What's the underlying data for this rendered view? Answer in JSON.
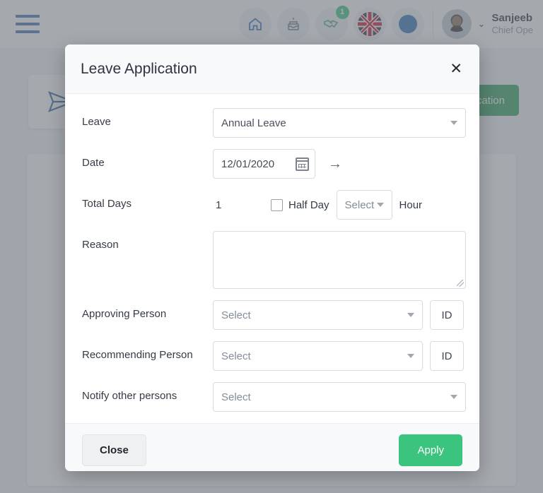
{
  "topbar": {
    "menu_icon": "hamburger-icon",
    "icons": [
      {
        "name": "home-icon",
        "glyph": "⌂",
        "color": "#2f6fb5",
        "badge": null
      },
      {
        "name": "cake-icon",
        "glyph": "⌂",
        "color": "#7b828c",
        "badge": null
      },
      {
        "name": "handshake-icon",
        "glyph": "⌂",
        "color": "#4fae7d",
        "badge": "1"
      },
      {
        "name": "flag-uk-icon",
        "glyph": "⌂",
        "color": "#c8102e",
        "badge": null
      },
      {
        "name": "status-dot-icon",
        "glyph": "●",
        "color": "#2f6fb5",
        "badge": null
      }
    ],
    "user": {
      "name": "Sanjeeb",
      "role": "Chief Ope",
      "chevron": "⌄"
    }
  },
  "background": {
    "send_icon": "send-icon",
    "apply_button_label": "cation"
  },
  "modal": {
    "title": "Leave Application",
    "close_icon": "✕",
    "fields": {
      "leave": {
        "label": "Leave",
        "value": "Annual Leave"
      },
      "date": {
        "label": "Date",
        "value": "12/01/2020",
        "calendar_icon": "calendar-icon",
        "arrow_icon": "→"
      },
      "total_days": {
        "label": "Total Days",
        "value": "1",
        "half_day_label": "Half Day",
        "half_day_checked": false,
        "hour_select_placeholder": "Select",
        "hour_label": "Hour"
      },
      "reason": {
        "label": "Reason",
        "value": ""
      },
      "approving_person": {
        "label": "Approving Person",
        "placeholder": "Select",
        "id_button_label": "ID"
      },
      "recommending_person": {
        "label": "Recommending Person",
        "placeholder": "Select",
        "id_button_label": "ID"
      },
      "notify_other_persons": {
        "label": "Notify other persons",
        "placeholder": "Select"
      }
    },
    "footer": {
      "close_label": "Close",
      "apply_label": "Apply"
    }
  },
  "colors": {
    "accent_green": "#3ac47d",
    "accent_blue": "#3f6fb0",
    "badge_green": "#3ac47d",
    "bg_apply_green": "#2e9e5b"
  }
}
